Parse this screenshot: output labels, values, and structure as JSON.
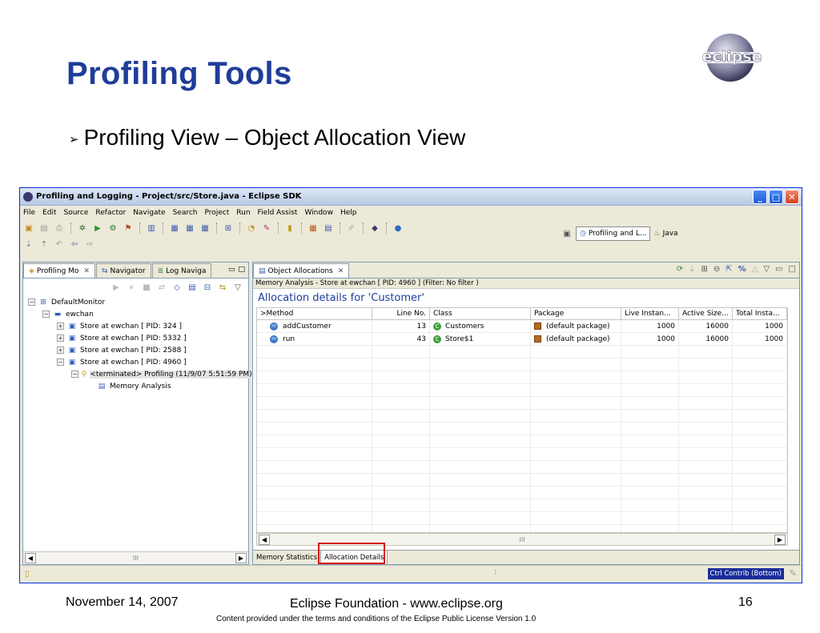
{
  "slide": {
    "title": "Profiling Tools",
    "bullet": "Profiling View – Object Allocation View",
    "logo_text": "eclipse",
    "footer": {
      "date": "November 14, 2007",
      "center": "Eclipse Foundation - www.eclipse.org",
      "license": "Content provided under the terms and conditions of the Eclipse Public License Version 1.0",
      "page": "16"
    }
  },
  "window": {
    "title": "Profiling and Logging - Project/src/Store.java - Eclipse SDK",
    "menu": [
      "File",
      "Edit",
      "Source",
      "Refactor",
      "Navigate",
      "Search",
      "Project",
      "Run",
      "Field Assist",
      "Window",
      "Help"
    ],
    "perspectives": {
      "active": "Profiling and L...",
      "other": "Java"
    }
  },
  "left_pane": {
    "tabs": [
      "Profiling Mo",
      "Navigator",
      "Log Naviga"
    ],
    "tree": [
      {
        "label": "DefaultMonitor"
      },
      {
        "label": "ewchan"
      },
      {
        "label": "Store at ewchan [ PID: 324 ]"
      },
      {
        "label": "Store at ewchan [ PID: 5332 ]"
      },
      {
        "label": "Store at ewchan [ PID: 2588 ]"
      },
      {
        "label": "Store at ewchan [ PID: 4960 ]"
      },
      {
        "label": "<terminated> Profiling (11/9/07 5:51:59 PM)"
      },
      {
        "label": "Memory Analysis"
      }
    ],
    "scroll_label": "III"
  },
  "right_pane": {
    "tab": "Object Allocations",
    "info": "Memory Analysis - Store at ewchan [ PID: 4960 ]  (Filter: No filter )",
    "heading": "Allocation details for 'Customer'",
    "columns": [
      ">Method",
      "Line No.",
      "Class",
      "Package",
      "Live Instan...",
      "Active Size...",
      "Total Insta..."
    ],
    "rows": [
      {
        "method": "addCustomer",
        "line": "13",
        "class": "Customers",
        "package": "(default package)",
        "live": "1000",
        "size": "16000",
        "total": "1000"
      },
      {
        "method": "run",
        "line": "43",
        "class": "Store$1",
        "package": "(default package)",
        "live": "1000",
        "size": "16000",
        "total": "1000"
      }
    ],
    "scroll_label": "III",
    "bottom_tabs": [
      "Memory Statistics",
      "Allocation Details"
    ],
    "highlight_color": "#d31616"
  },
  "statusbar": {
    "contrib": "Ctrl Contrib (Bottom)"
  }
}
